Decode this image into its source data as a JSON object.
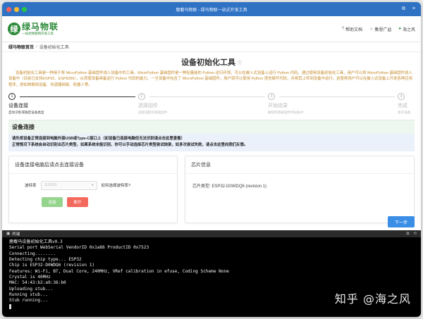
{
  "window": {
    "title": "鹿載马物联 - 绿马物联一站式开发工具",
    "traffic_colors": [
      "#ff5f57",
      "#febc2e",
      "#28c840"
    ]
  },
  "header": {
    "logo_mark": "绿",
    "logo_main": "绿马物联",
    "logo_sub": "一站式物联网开发工具",
    "items": [
      {
        "icon": "help-icon",
        "label": "帮助文档"
      },
      {
        "icon": "star-icon",
        "label": "集恩广益"
      },
      {
        "icon": "user-icon",
        "label": "海之风"
      }
    ]
  },
  "breadcrumb": {
    "home": "绿马物联首页",
    "separator": "/",
    "current": "设备初始化工具"
  },
  "page": {
    "title": "设备初始化工具",
    "description": "设备初始化工具是一种用于将 MicroPython 基础固件烧入设备中的工具。MicroPython 基础固件是一种轻量级的 Python 运行环境，可以在嵌入式设备上运行 Python 代码。通过使用设备初始化工具，用户可以将 MicroPython 基础固件烧入设备中（目前已支持ESP32、ESP8266），从而使设备具备运行 Python 代码的能力。一旦设备中包含了 MicroPython 基础固件，用户就可以使用 Python 语言编写代码，并将其上传到设备中运行。这使得用户可以在嵌入式设备上开发各种应用程序，例如物联网设备、传感器网络、机器人等。"
  },
  "steps": [
    {
      "num": "1",
      "title": "设备连接",
      "desc": "自动识别或确定设备类型",
      "active": true
    },
    {
      "num": "2",
      "title": "选择固件",
      "desc": "选择适配的基础固件",
      "active": false
    },
    {
      "num": "3",
      "title": "开始烧录",
      "desc": "删除和烧录固件到设备中",
      "active": false
    },
    {
      "num": "4",
      "title": "完成",
      "desc": "单开设备",
      "active": false
    }
  ],
  "section": {
    "title": "设备连接",
    "notice_line1": "请先将设备正常连接到电脑外接USB或Type-C接口上（如设备已连接电脑但无法识别请点击这里查看）",
    "notice_line2": "正常情况下系统会自动识别出芯片类型，如果系统未能识别，你可以手动选择芯片类型尝试烧录，如多次尝试失败，请点击这里向我们反馈。"
  },
  "connect_panel": {
    "title": "设备连接电脑后请点击连接设备",
    "baud_label": "波特率",
    "baud_value": "115200",
    "baud_help": "如何选择波特率?",
    "connect_label": "连接",
    "disconnect_label": "断开",
    "connect_color": "#95d48d",
    "disconnect_color": "#f4695d"
  },
  "chip_panel": {
    "title": "芯片信息",
    "chip_label": "芯片类型:",
    "chip_value": "ESP32-D0WDQ6 (revision 1)"
  },
  "next_label": "下一步",
  "terminal": {
    "label": "终端",
    "lines": [
      "鹿載马设备初始化工具v0.3",
      "Serial port WebSerial VendorID 0x1a86 ProductID 0x7523",
      "Connecting........",
      "Detecting chip type... ESP32",
      "Chip is ESP32-D0WDQ6 (revision 1)",
      "Features: Wi-Fi, BT, Dual Core, 240MHz, VRef calibration in efuse, Coding Scheme None",
      "Crystal is 40MHz",
      "MAC: 54:43:b2:a9:36:b0",
      "Uploading stub...",
      "Running stub...",
      "Stub running..."
    ]
  },
  "watermark": "知乎 @海之风"
}
